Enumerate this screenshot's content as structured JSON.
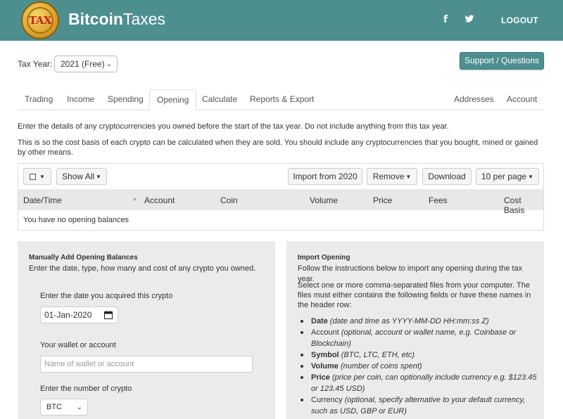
{
  "header": {
    "logo_text": "TAX",
    "brand_bold": "Bitcoin",
    "brand_light": "Taxes",
    "facebook_glyph": "f",
    "logout_label": "LOGOUT",
    "theme_color": "#4d8f8f"
  },
  "taxyear": {
    "label": "Tax Year:",
    "selected": "2021 (Free)"
  },
  "support_label": "Support / Questions",
  "tabs": {
    "trading": "Trading",
    "income": "Income",
    "spending": "Spending",
    "opening": "Opening",
    "calculate": "Calculate",
    "reports": "Reports & Export",
    "addresses": "Addresses",
    "account": "Account"
  },
  "intro": {
    "line1": "Enter the details of any cryptocurrencies you owned before the start of the tax year. Do not include anything from this tax year.",
    "line2": "This is so the cost basis of each crypto can be calculated when they are sold. You should include any cryptocurrencies that you bought, mined or gained by other means."
  },
  "toolbar": {
    "show_all": "Show All",
    "import_prev": "Import from 2020",
    "remove": "Remove",
    "download": "Download",
    "per_page": "10 per page"
  },
  "table": {
    "columns": [
      "Date/Time",
      "Account",
      "Coin",
      "Volume",
      "Price",
      "Fees",
      "Cost Basis"
    ],
    "empty_message": "You have no opening balances"
  },
  "manual": {
    "title": "Manually Add Opening Balances",
    "desc": "Enter the date, type, how many and cost of any crypto you owned.",
    "date_label": "Enter the date you acquired this crypto",
    "date_value": "01-Jan-2020",
    "wallet_label": "Your wallet or account",
    "wallet_placeholder": "Name of wallet or account",
    "number_label": "Enter the number of crypto",
    "coin_selected": "BTC"
  },
  "import": {
    "title": "Import Opening",
    "desc": "Follow the instructions below to import any opening during the tax year.",
    "files_desc": "Select one or more comma-separated files from your computer. The files must either contains the following fields or have these names in the header row:",
    "fields": [
      {
        "name": "Date",
        "note": "(date and time as YYYY-MM-DD HH:mm:ss Z)",
        "bold": true
      },
      {
        "name": "Account",
        "note": "(optional, account or wallet name, e.g. Coinbase or Blockchain)",
        "bold": false
      },
      {
        "name": "Symbol",
        "note": "(BTC, LTC, ETH, etc)",
        "bold": true
      },
      {
        "name": "Volume",
        "note": "(number of coins spent)",
        "bold": true
      },
      {
        "name": "Price",
        "note": "(price per coin, can optionally include currency e.g. $123.45 or 123.45 USD)",
        "bold": true
      },
      {
        "name": "Currency",
        "note": "(optional, specify alternative to your default currency, such as USD, GBP or EUR)",
        "bold": false
      }
    ]
  }
}
